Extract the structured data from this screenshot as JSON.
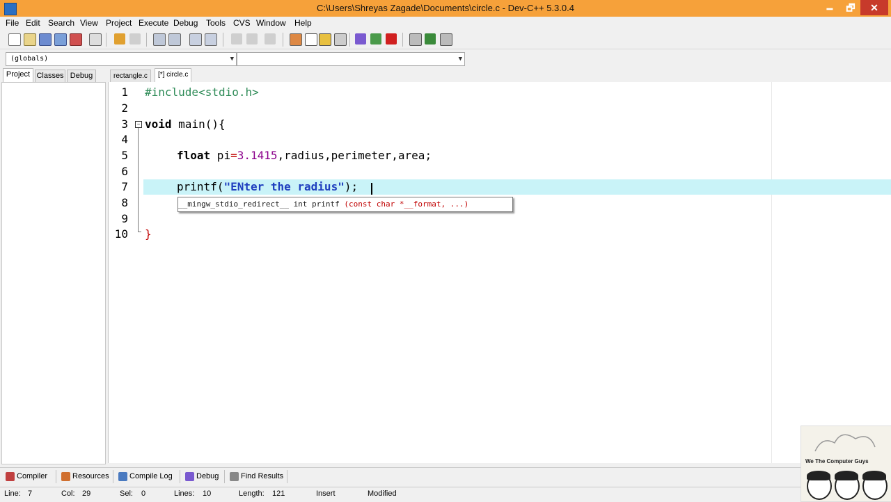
{
  "window": {
    "title": "C:\\Users\\Shreyas Zagade\\Documents\\circle.c - Dev-C++ 5.3.0.4",
    "min_glyph": "🗕",
    "max_glyph": "🗗",
    "close_glyph": "✕"
  },
  "menu": [
    "File",
    "Edit",
    "Search",
    "View",
    "Project",
    "Execute",
    "Debug",
    "Tools",
    "CVS",
    "Window",
    "Help"
  ],
  "toolbar2": {
    "class_combo": "(globals)",
    "member_combo": ""
  },
  "left_tabs": [
    "Project",
    "Classes",
    "Debug"
  ],
  "editor_tabs": [
    "rectangle.c",
    "[*] circle.c"
  ],
  "line_numbers": [
    "1",
    "2",
    "3",
    "4",
    "5",
    "6",
    "7",
    "8",
    "9",
    "10"
  ],
  "code": {
    "l1": "#include<stdio.h>",
    "l3_kw": "void",
    "l3_rest": " main(){",
    "l5_kw": "float",
    "l5_a": " pi",
    "l5_eq": "=",
    "l5_num": "3.1415",
    "l5_rest": ",radius,perimeter,area;",
    "l7_fn": "printf(",
    "l7_str": "\"ENter the radius\"",
    "l7_end": ");",
    "l10": "}"
  },
  "calltip": {
    "prefix": "__mingw_stdio_redirect__ int printf ",
    "params": "(const char *__format, ...)"
  },
  "bottom_tabs": [
    "Compiler",
    "Resources",
    "Compile Log",
    "Debug",
    "Find Results"
  ],
  "status": {
    "line_label": "Line:",
    "line": "7",
    "col_label": "Col:",
    "col": "29",
    "sel_label": "Sel:",
    "sel": "0",
    "lines_label": "Lines:",
    "lines": "10",
    "length_label": "Length:",
    "length": "121",
    "mode": "Insert",
    "modified": "Modified"
  },
  "watermark": {
    "text": "We The Computer Guys"
  },
  "colors": {
    "titlebar": "#f6a13a",
    "current_line": "#c9f3f8",
    "preprocessor": "#2e8b57",
    "string": "#1f3fbf",
    "number": "#8b008b"
  }
}
